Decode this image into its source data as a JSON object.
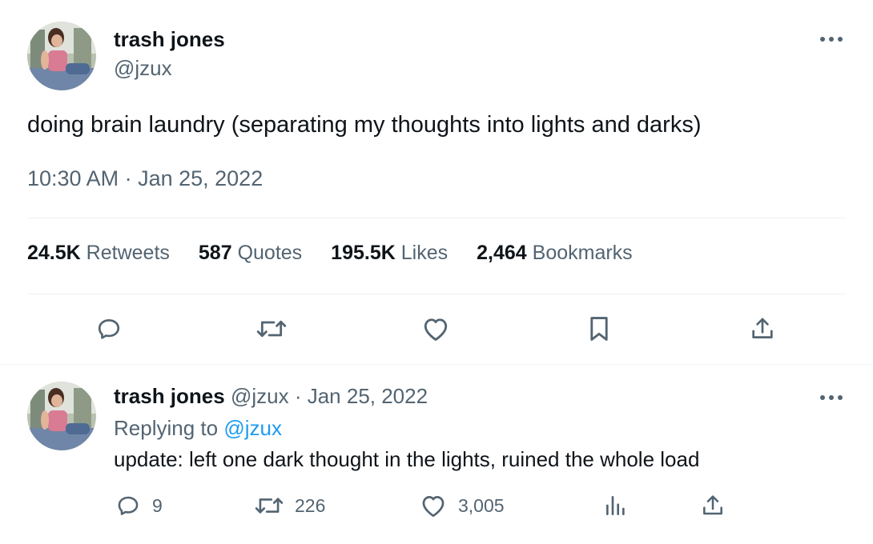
{
  "main_tweet": {
    "author_name": "trash jones",
    "author_handle": "@jzux",
    "text": "doing brain laundry (separating my thoughts into lights and darks)",
    "timestamp": "10:30 AM · Jan 25, 2022",
    "stats": [
      {
        "value": "24.5K",
        "label": "Retweets"
      },
      {
        "value": "587",
        "label": "Quotes"
      },
      {
        "value": "195.5K",
        "label": "Likes"
      },
      {
        "value": "2,464",
        "label": "Bookmarks"
      }
    ],
    "actions": [
      "reply-icon",
      "retweet-icon",
      "like-icon",
      "bookmark-icon",
      "share-icon"
    ]
  },
  "reply_tweet": {
    "author_name": "trash jones",
    "author_handle": "@jzux",
    "date": "· Jan 25, 2022",
    "replying_prefix": "Replying to",
    "replying_to": "@jzux",
    "text": "update: left one dark thought in the lights, ruined the whole load",
    "reply_count": "9",
    "retweet_count": "226",
    "like_count": "3,005"
  },
  "colors": {
    "text_primary": "#0f1419",
    "text_secondary": "#536471",
    "link": "#1d9bf0",
    "divider": "#eff3f4"
  }
}
